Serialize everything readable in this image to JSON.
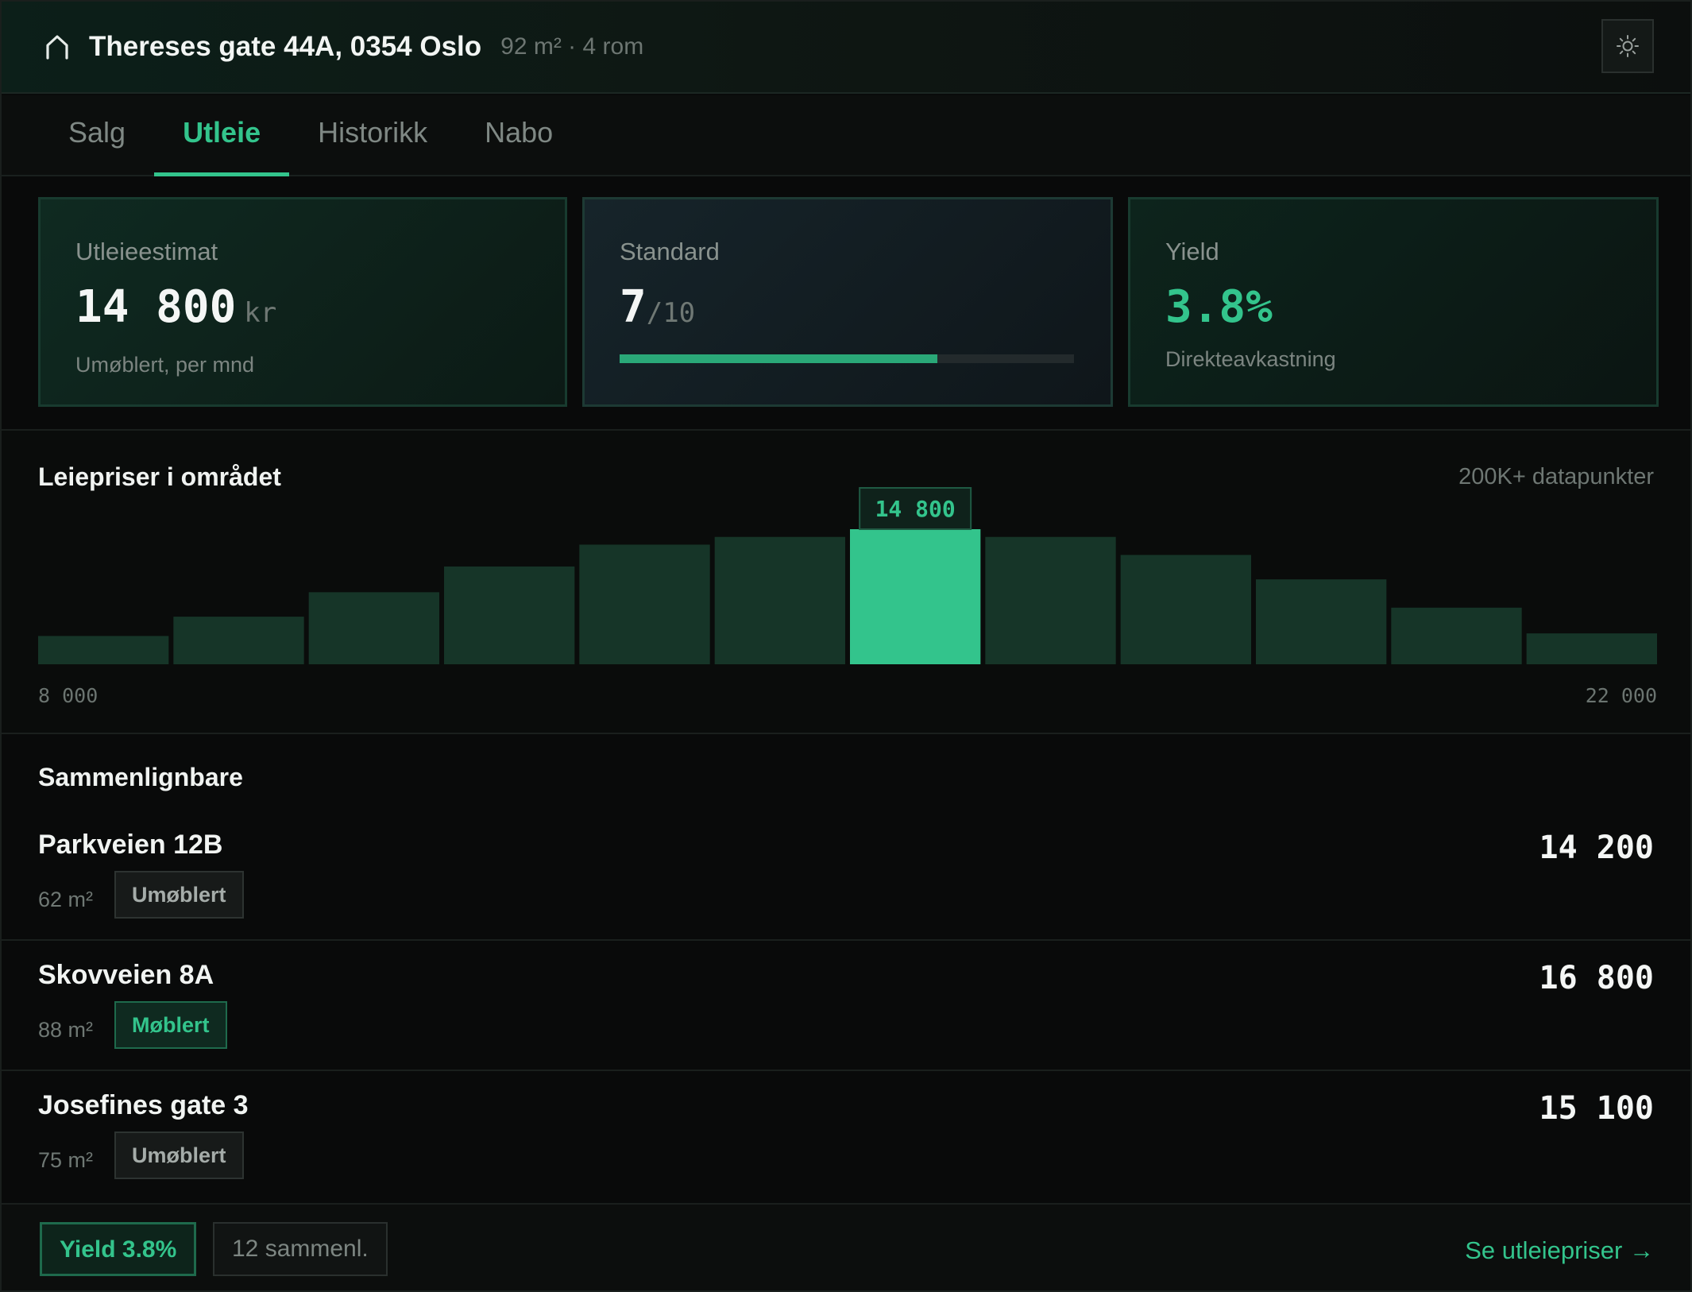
{
  "header": {
    "home_icon": "home-icon",
    "title": "Thereses gate 44A, 0354 Oslo",
    "meta": "92 m² · 4 rom",
    "theme_icon": "sun-icon"
  },
  "tabs": [
    {
      "label": "Salg",
      "active": false
    },
    {
      "label": "Utleie",
      "active": true
    },
    {
      "label": "Historikk",
      "active": false
    },
    {
      "label": "Nabo",
      "active": false
    }
  ],
  "cards": {
    "estimate": {
      "label": "Utleieestimat",
      "value": "14 800",
      "unit": "kr",
      "sub": "Umøblert, per mnd"
    },
    "standard": {
      "label": "Standard",
      "value": "7",
      "max": "/10",
      "score": 7,
      "scale": 10
    },
    "yield": {
      "label": "Yield",
      "value": "3.8%",
      "sub": "Direkteavkastning"
    }
  },
  "chart": {
    "title": "Leiepriser i området",
    "note": "200K+ datapunkter",
    "chart_data": {
      "type": "bar",
      "x_range_labels": [
        "8 000",
        "22 000"
      ],
      "values": [
        2.2,
        3.7,
        5.6,
        7.6,
        9.3,
        9.9,
        10.5,
        9.9,
        8.5,
        6.6,
        4.4,
        2.4
      ],
      "highlight_index": 6,
      "highlight_label": "14 800",
      "colors": {
        "bar": "#163528",
        "highlight": "#33c48c"
      }
    }
  },
  "comparables": {
    "title": "Sammenlignbare",
    "items": [
      {
        "address": "Parkveien 12B",
        "size": "62 m²",
        "badge": "Umøblert",
        "furnished": false,
        "price": "14 200"
      },
      {
        "address": "Skovveien 8A",
        "size": "88 m²",
        "badge": "Møblert",
        "furnished": true,
        "price": "16 800"
      },
      {
        "address": "Josefines gate 3",
        "size": "75 m²",
        "badge": "Umøblert",
        "furnished": false,
        "price": "15 100"
      }
    ]
  },
  "footer": {
    "yield_chip": "Yield 3.8%",
    "count_chip": "12 sammenl.",
    "link": "Se utleiepriser →"
  },
  "colors": {
    "accent": "#33c48c",
    "background": "#090a0a"
  }
}
